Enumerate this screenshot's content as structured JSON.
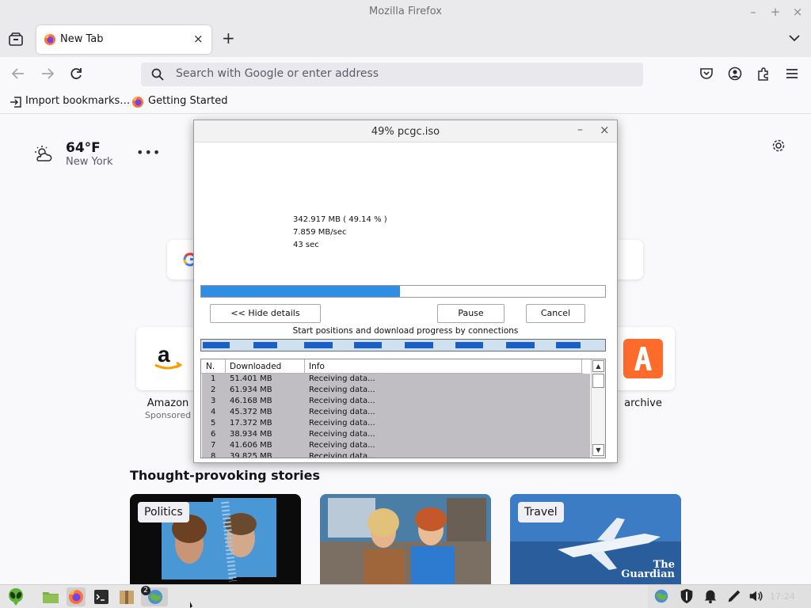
{
  "window": {
    "title": "Mozilla Firefox"
  },
  "tabs": [
    {
      "label": "New Tab"
    }
  ],
  "urlbar": {
    "placeholder": "Search with Google or enter address"
  },
  "bookmarks": [
    {
      "label": "Import bookmarks…"
    },
    {
      "label": "Getting Started"
    }
  ],
  "weather": {
    "temp": "64°F",
    "location": "New York"
  },
  "shortcuts": [
    {
      "label": "Amazon",
      "sub": "Sponsored"
    },
    {
      "label": "archive",
      "sub": ""
    }
  ],
  "stories": {
    "heading": "Thought-provoking stories",
    "cards": [
      {
        "tag": "Politics"
      },
      {
        "tag": ""
      },
      {
        "tag": "Travel",
        "publisher": "The Guardian"
      }
    ]
  },
  "dialog": {
    "title": "49% pcgc.iso",
    "downloaded": "342.917  MB  ( 49.14 % )",
    "speed": "7.859  MB/sec",
    "remaining": "43 sec",
    "progress_fraction": 0.4914,
    "buttons": {
      "hide_details": "<< Hide details",
      "pause": "Pause",
      "cancel": "Cancel"
    },
    "connections_caption": "Start positions and download progress by connections",
    "connection_progress": [
      0.45,
      0.4,
      0.48,
      0.45,
      0.47,
      0.46,
      0.48,
      0.4
    ],
    "table": {
      "headers": [
        "N.",
        "Downloaded",
        "Info"
      ],
      "rows": [
        [
          "1",
          "51.401  MB",
          "Receiving data..."
        ],
        [
          "2",
          "61.934  MB",
          "Receiving data..."
        ],
        [
          "3",
          "46.168  MB",
          "Receiving data..."
        ],
        [
          "4",
          "45.372  MB",
          "Receiving data..."
        ],
        [
          "5",
          "17.372  MB",
          "Receiving data..."
        ],
        [
          "6",
          "38.934  MB",
          "Receiving data..."
        ],
        [
          "7",
          "41.606  MB",
          "Receiving data..."
        ],
        [
          "8",
          "39.825  MB",
          "Receiving data..."
        ]
      ]
    }
  },
  "taskbar": {
    "badge": "2",
    "clock": "17:24"
  },
  "colors": {
    "accent": "#2f8de4",
    "segment": "#1c5fc2",
    "table_selection": "#c1bec3",
    "firefox_orange": "#ff7139"
  }
}
